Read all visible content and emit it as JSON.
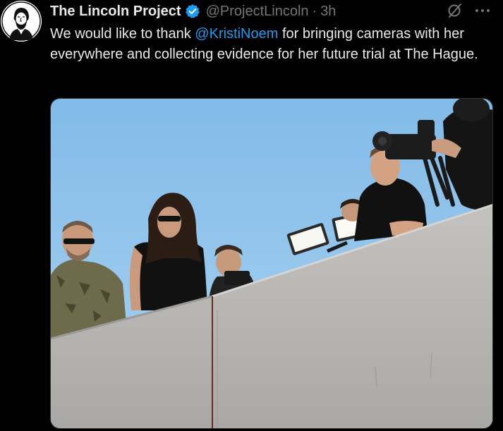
{
  "tweet": {
    "author": {
      "display_name": "The Lincoln Project",
      "handle": "@ProjectLincoln",
      "verified": true,
      "avatar_icon": "lincoln-portrait-icon"
    },
    "separator": "·",
    "timestamp": "3h",
    "text": {
      "before_mention": "We would like to thank ",
      "mention": "@KristiNoem",
      "after_mention": " for bringing cameras with her everywhere and collecting evidence for her future trial at The Hague."
    },
    "actions": {
      "grok_icon": "grok-icon",
      "more_icon": "more-options-icon"
    },
    "media": {
      "type": "photo"
    }
  },
  "colors": {
    "background": "#000000",
    "text_primary": "#e7e9ea",
    "text_secondary": "#71767b",
    "accent": "#1d9bf0",
    "sky": "#8fc2ea",
    "wall": "#b8b6b3"
  }
}
